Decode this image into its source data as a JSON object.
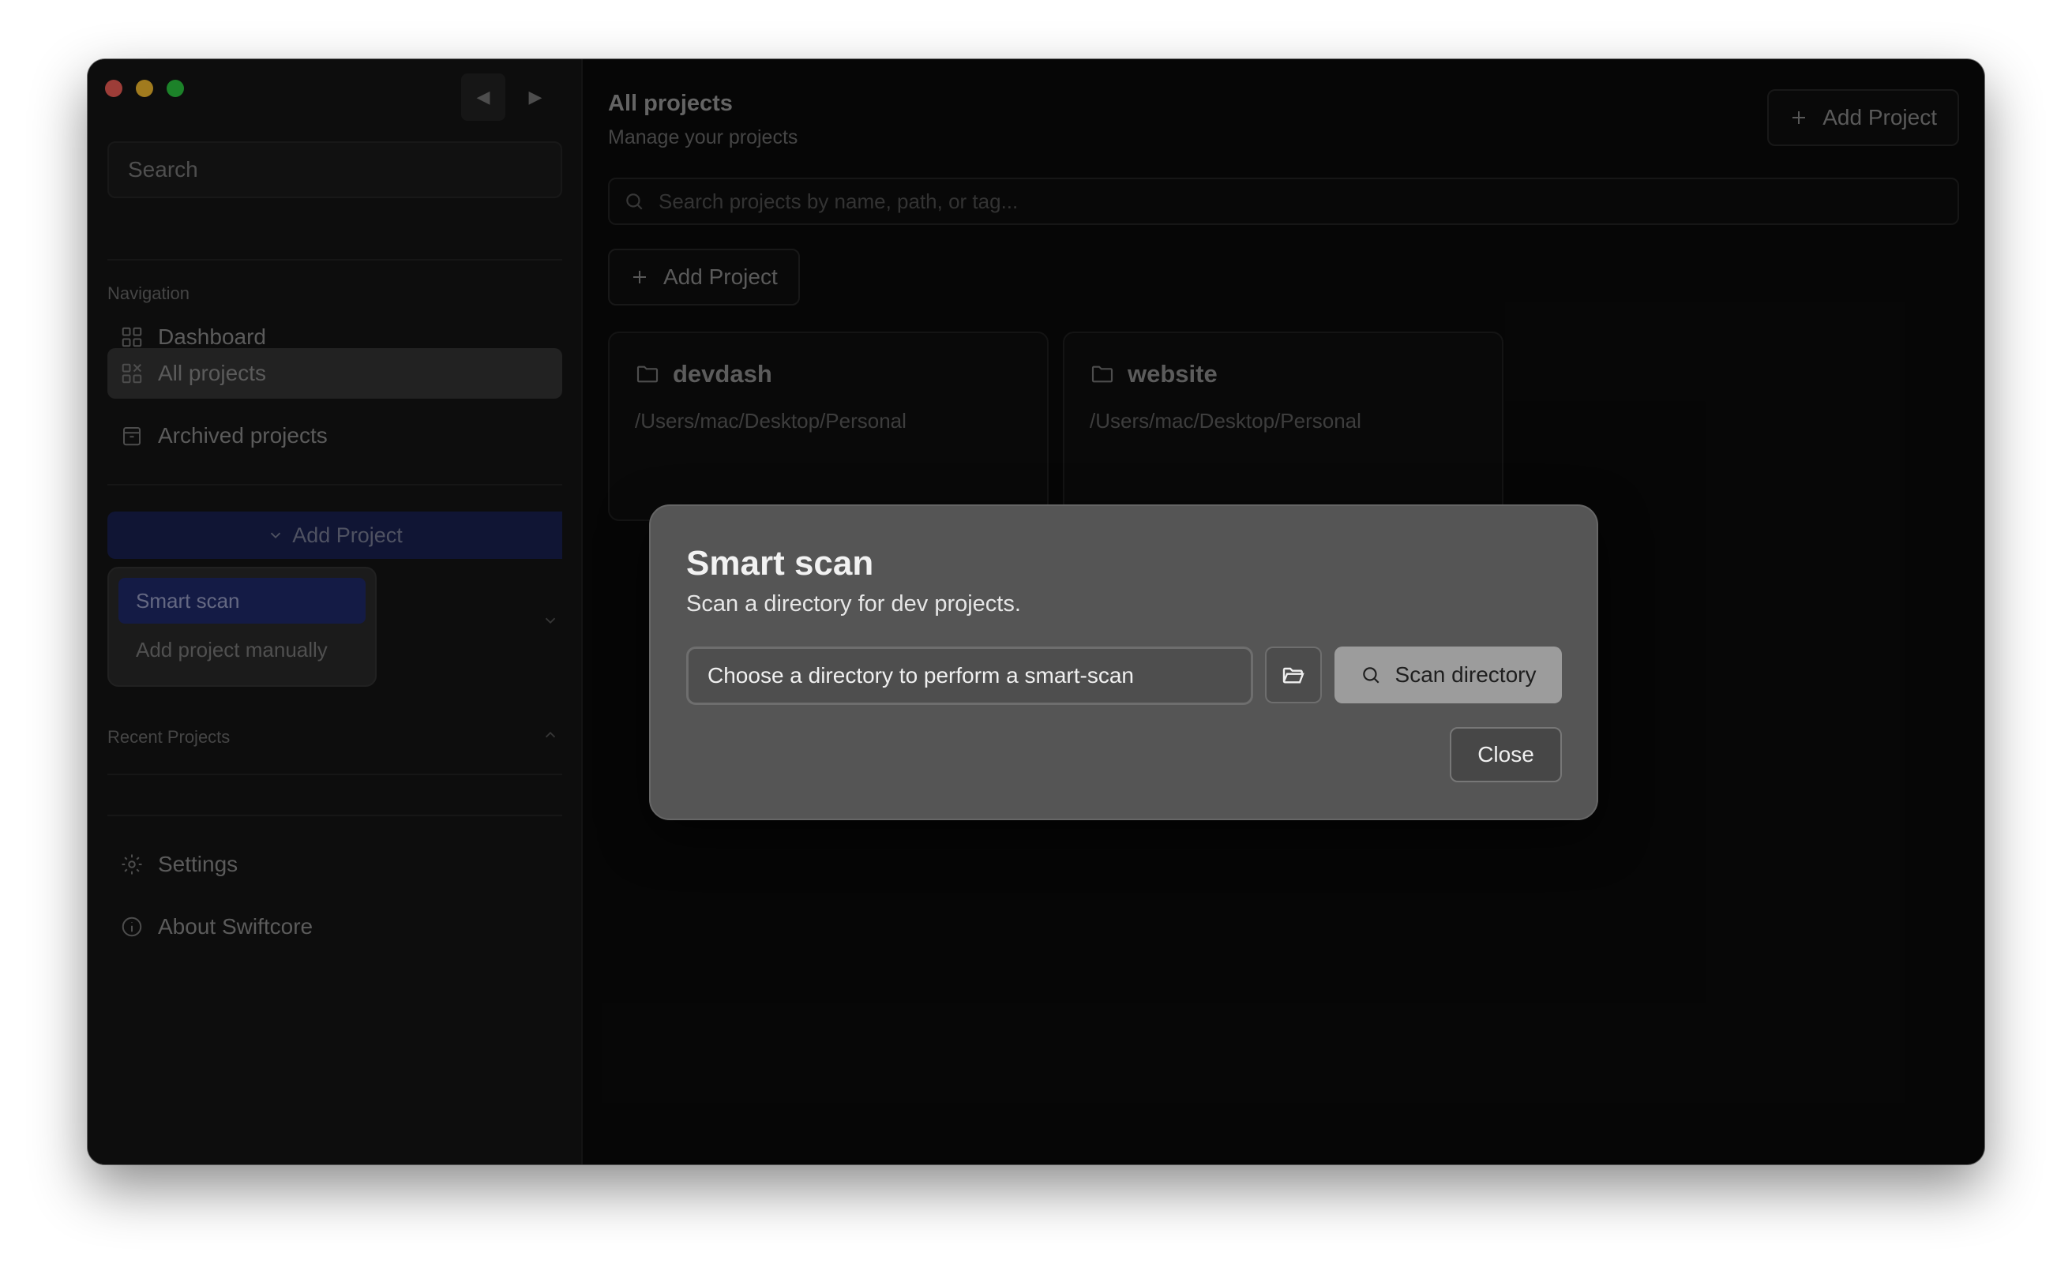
{
  "sidebar": {
    "search_placeholder": "Search",
    "navigation_label": "Navigation",
    "items": [
      {
        "label": "Dashboard",
        "icon": "grid-icon"
      },
      {
        "label": "All projects",
        "icon": "apps-icon"
      },
      {
        "label": "Archived projects",
        "icon": "archive-icon"
      }
    ],
    "add_project_label": "Add Project",
    "dropdown": [
      {
        "label": "Smart scan"
      },
      {
        "label": "Add project manually"
      }
    ],
    "recent_label": "Recent Projects",
    "footer": [
      {
        "label": "Settings",
        "icon": "gear-icon"
      },
      {
        "label": "About Swiftcore",
        "icon": "info-icon"
      }
    ]
  },
  "main": {
    "title": "All projects",
    "subtitle": "Manage your projects",
    "add_project_label": "Add Project",
    "search_placeholder": "Search projects by name, path, or tag...",
    "cards": [
      {
        "name": "devdash",
        "path": "/Users/mac/Desktop/Personal"
      },
      {
        "name": "website",
        "path": "/Users/mac/Desktop/Personal"
      }
    ]
  },
  "modal": {
    "title": "Smart scan",
    "subtitle": "Scan a directory for dev projects.",
    "directory_placeholder": "Choose a directory to perform a smart-scan",
    "scan_label": "Scan directory",
    "close_label": "Close"
  },
  "colors": {
    "accent_blue": "#202a6a",
    "modal_bg": "#555555",
    "window_bg": "#0a0a0a"
  }
}
